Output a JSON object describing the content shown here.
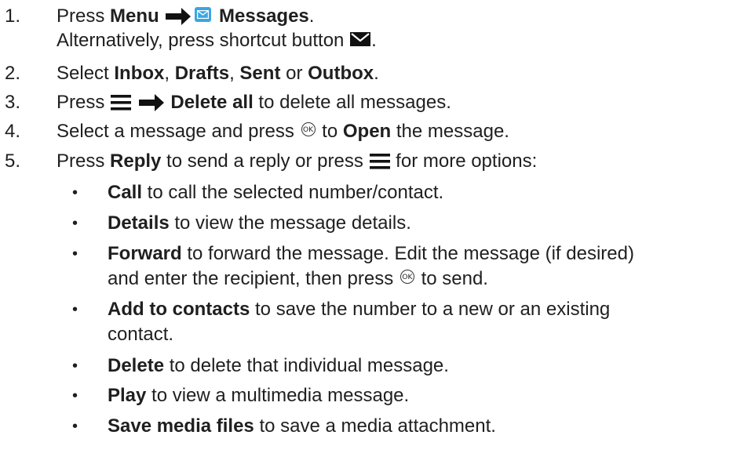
{
  "steps": [
    {
      "num": "1.",
      "line1_pre": "Press ",
      "menu": "Menu",
      "messages": "Messages",
      "line1_post": ".",
      "line2": "Alternatively, press shortcut button ",
      "line2_post": "."
    },
    {
      "num": "2.",
      "pre": "Select ",
      "inbox": "Inbox",
      "c1": ", ",
      "drafts": "Drafts",
      "c2": ", ",
      "sent": "Sent",
      "or": " or ",
      "outbox": "Outbox",
      "post": "."
    },
    {
      "num": "3.",
      "pre": "Press ",
      "delete_all": "Delete all",
      "post": " to delete all messages."
    },
    {
      "num": "4.",
      "pre": "Select a message and press ",
      "to": " to ",
      "open": "Open",
      "post": " the message."
    },
    {
      "num": "5.",
      "pre": "Press ",
      "reply": "Reply",
      "mid": " to send a reply or press ",
      "post": " for more options:"
    }
  ],
  "options": [
    {
      "label": "Call",
      "text": " to call the selected number/contact."
    },
    {
      "label": "Details",
      "text": " to view the message details."
    },
    {
      "label": "Forward",
      "text": " to forward the message. Edit the message (if desired)",
      "line2_pre": "and enter the recipient, then press ",
      "line2_post": " to send."
    },
    {
      "label": "Add to contacts",
      "text": " to save the number to a new or an existing",
      "line2": "contact."
    },
    {
      "label": "Delete",
      "text": " to delete that individual message."
    },
    {
      "label": "Play",
      "text": " to view a multimedia message."
    },
    {
      "label": "Save media files",
      "text": " to save a media attachment."
    }
  ],
  "bullet_char": "•",
  "ok_glyph": "OK",
  "icons": {
    "arrow": "right-arrow-icon",
    "messages": "envelope-app-icon",
    "shortcut": "envelope-button-icon",
    "options": "hamburger-menu-icon",
    "ok": "ok-button-icon"
  },
  "colors": {
    "text": "#1f1f1f",
    "messages_icon_bg": "#3aa6e3"
  }
}
